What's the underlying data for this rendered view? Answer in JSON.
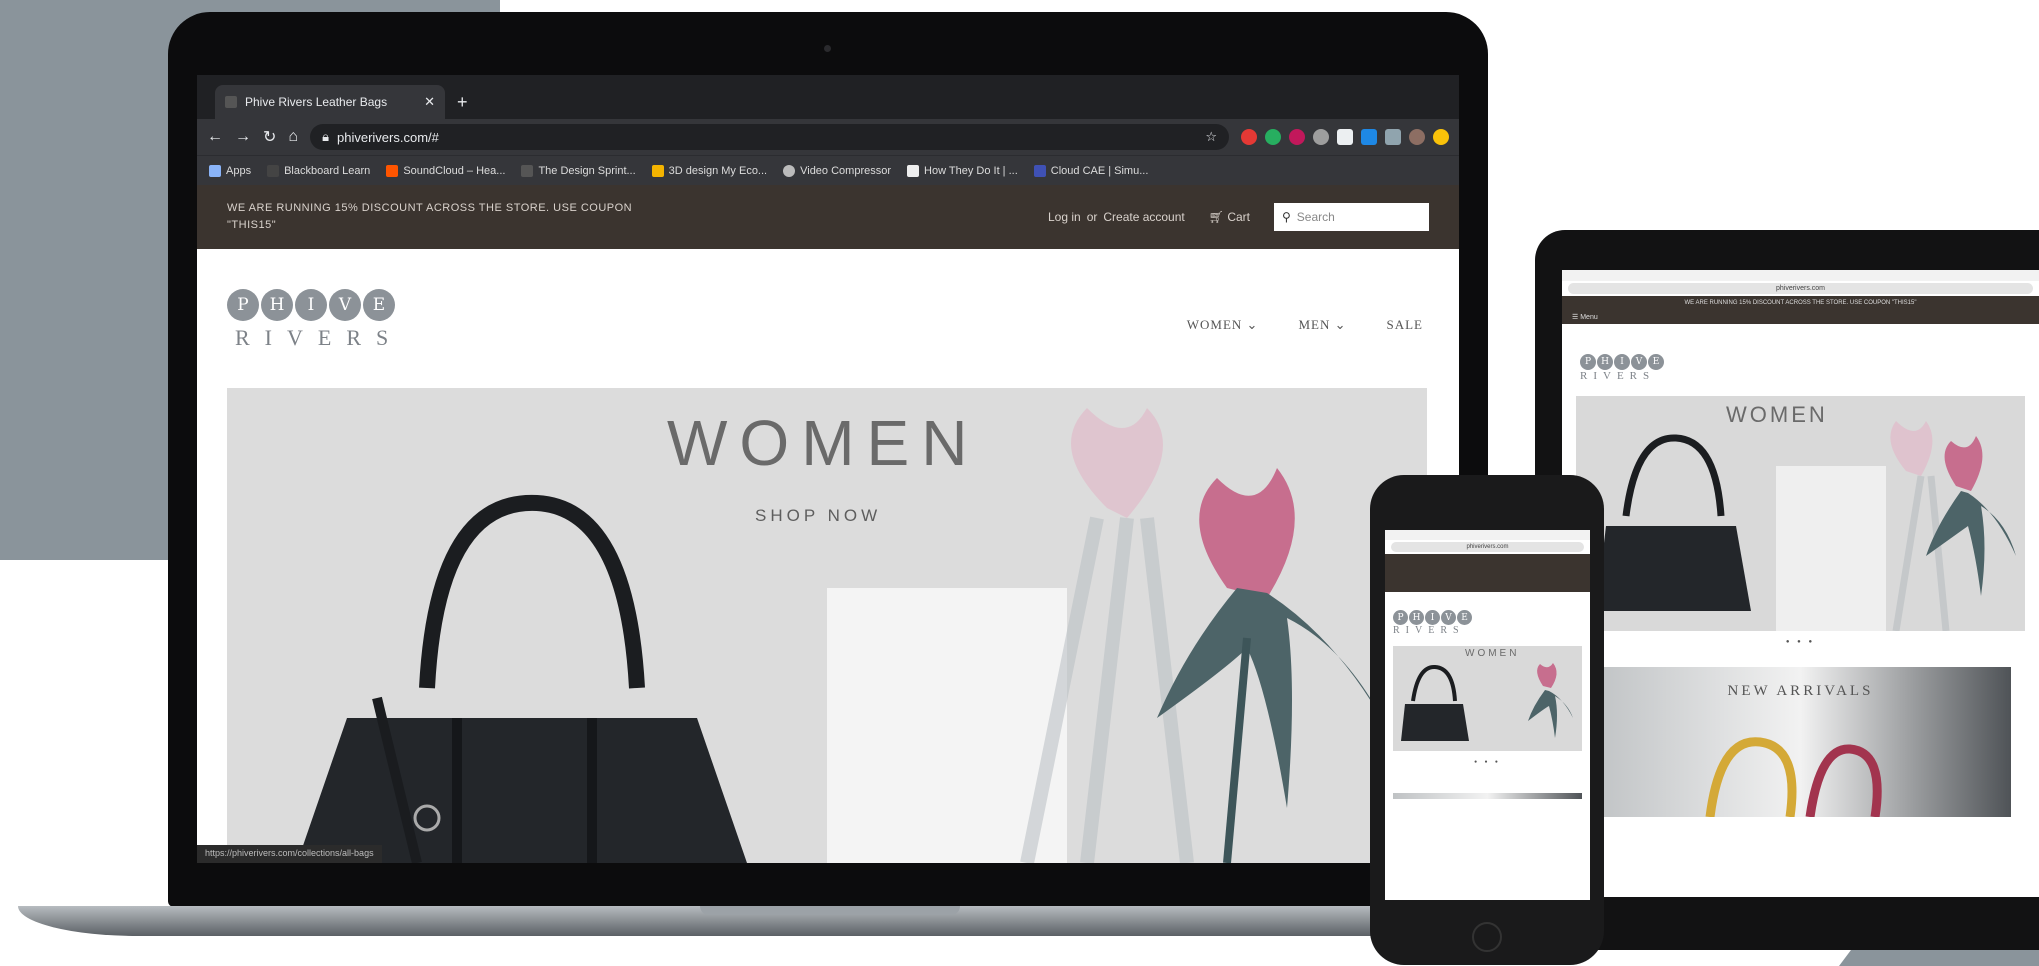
{
  "browser": {
    "tab_title": "Phive Rivers Leather Bags",
    "tab_close": "✕",
    "new_tab": "+",
    "url": "phiverivers.com/#",
    "bookmarks": [
      "Apps",
      "Blackboard Learn",
      "SoundCloud – Hea...",
      "The Design Sprint...",
      "3D design My Eco...",
      "Video Compressor",
      "How They Do It | ...",
      "Cloud CAE | Simu..."
    ],
    "status_url": "https://phiverivers.com/collections/all-bags"
  },
  "site": {
    "announcement": "WE ARE RUNNING 15% DISCOUNT ACROSS THE STORE. USE COUPON \"THIS15\"",
    "login": "Log in",
    "or": "or",
    "create_account": "Create account",
    "cart": "Cart",
    "search_placeholder": "Search",
    "logo_letters": [
      "P",
      "H",
      "I",
      "V",
      "E"
    ],
    "logo_sub": "RIVERS",
    "nav": [
      "WOMEN ⌄",
      "MEN ⌄",
      "SALE"
    ],
    "hero_title": "WOMEN",
    "hero_cta": "SHOP NOW"
  },
  "phone": {
    "url": "phiverivers.com",
    "hero_title": "WOMEN",
    "dots": "● ● ●"
  },
  "tablet": {
    "url": "phiverivers.com",
    "announcement": "WE ARE RUNNING 15% DISCOUNT ACROSS THE STORE. USE COUPON \"THIS15\"",
    "menu": "☰ Menu",
    "hero_title": "WOMEN",
    "dots": "● ● ●",
    "new_arrivals": "NEW ARRIVALS"
  },
  "colors": {
    "announcement_bg": "#3b342f",
    "logo_gray": "#8c9298",
    "slate": "#8a949b"
  }
}
